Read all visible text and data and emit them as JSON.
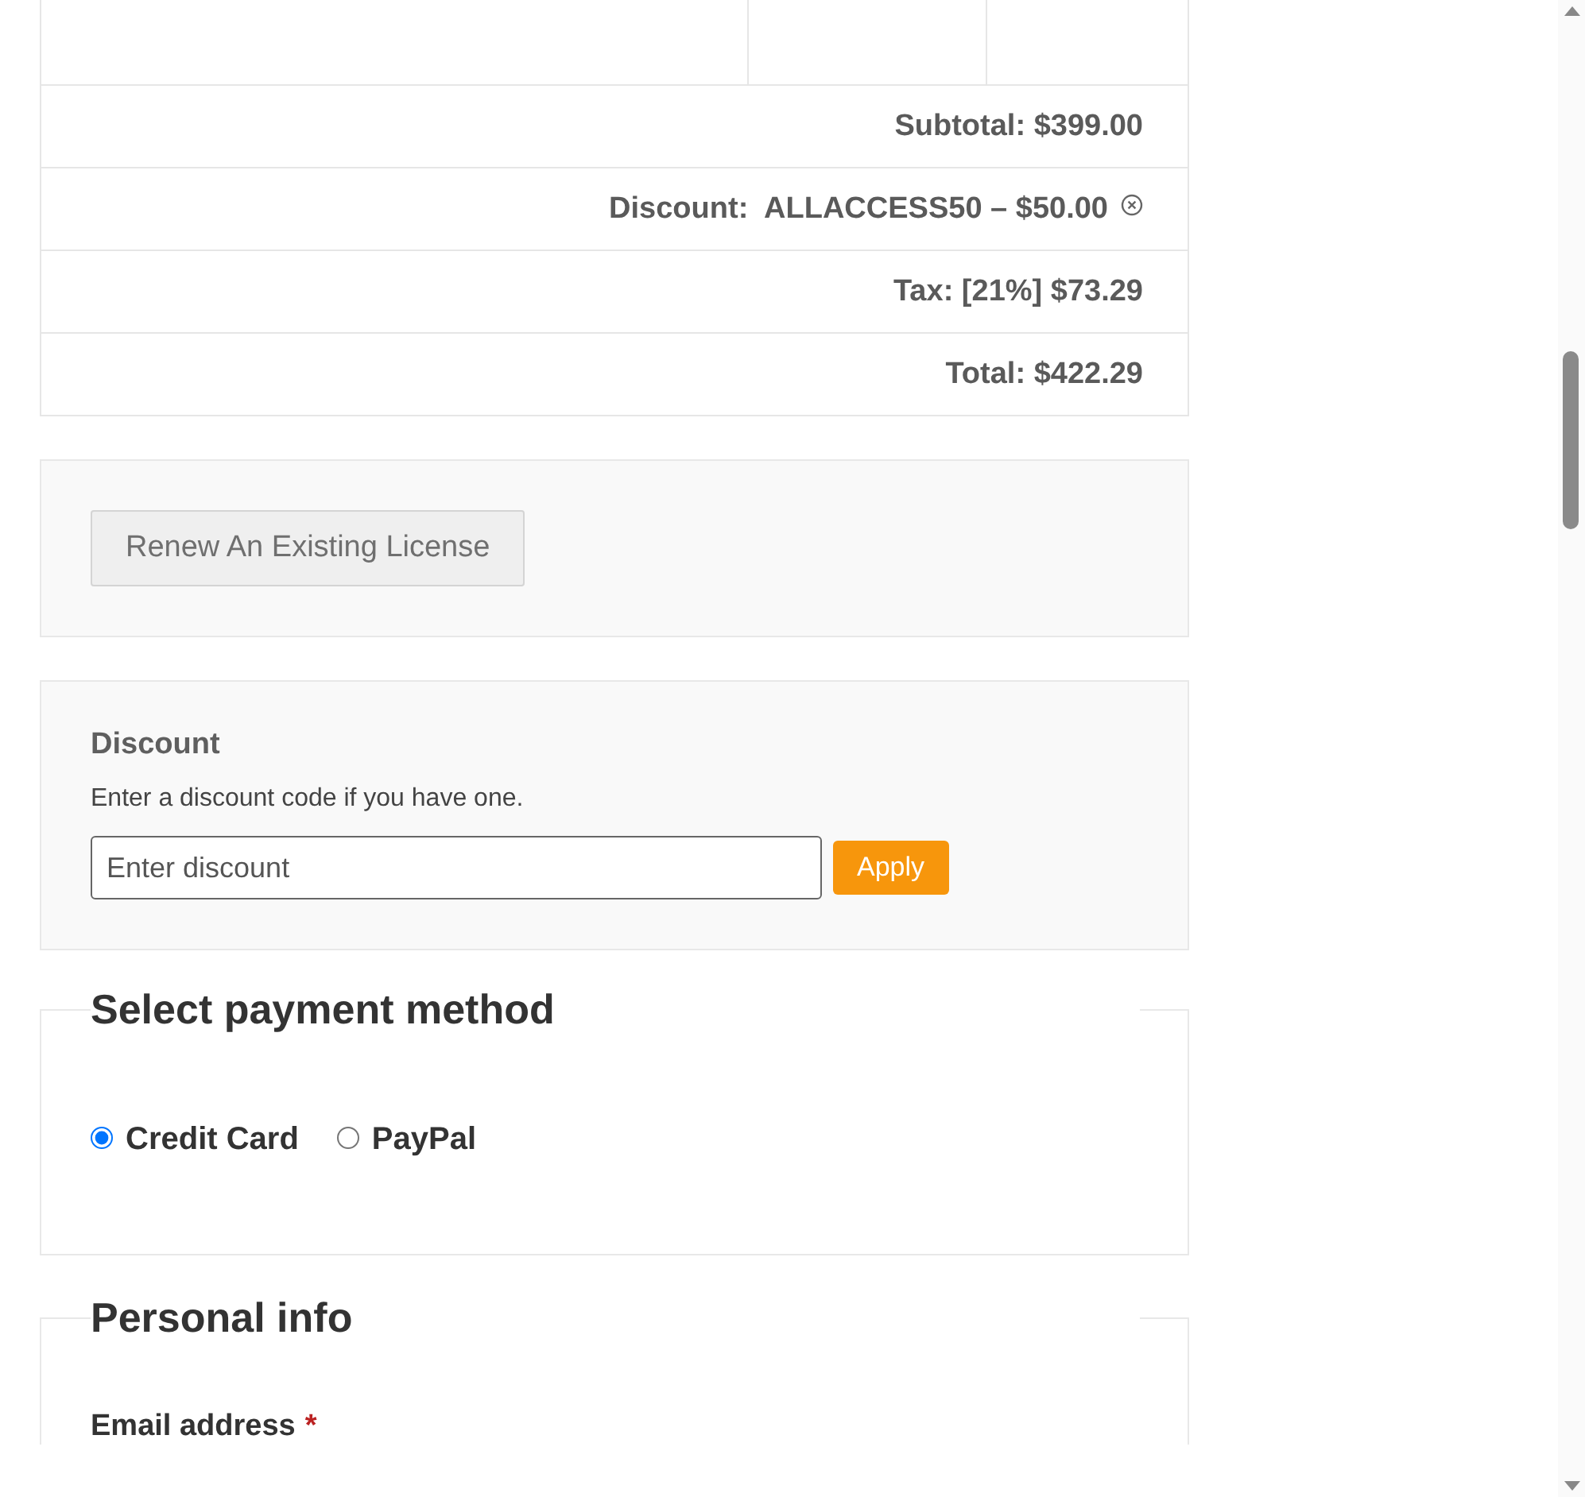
{
  "totals": [
    {
      "kind": "amount",
      "label": "Subtotal:",
      "value": "$399.00"
    },
    {
      "kind": "discount",
      "label": "Discount:",
      "value": "ALLACCESS50 – $50.00"
    },
    {
      "kind": "amount",
      "label": "Tax:",
      "value": "[21%] $73.29"
    },
    {
      "kind": "amount",
      "label": "Total:",
      "value": "$422.29"
    }
  ],
  "renew_button": "Renew An Existing License",
  "discount": {
    "title": "Discount",
    "hint": "Enter a discount code if you have one.",
    "placeholder": "Enter discount",
    "button": "Apply"
  },
  "payment": {
    "title": "Select payment method",
    "methods": [
      {
        "label": "Credit Card",
        "selected": true
      },
      {
        "label": "PayPal",
        "selected": false
      }
    ]
  },
  "personal": {
    "title": "Personal info",
    "email_label": "Email address",
    "required_mark": "*"
  }
}
